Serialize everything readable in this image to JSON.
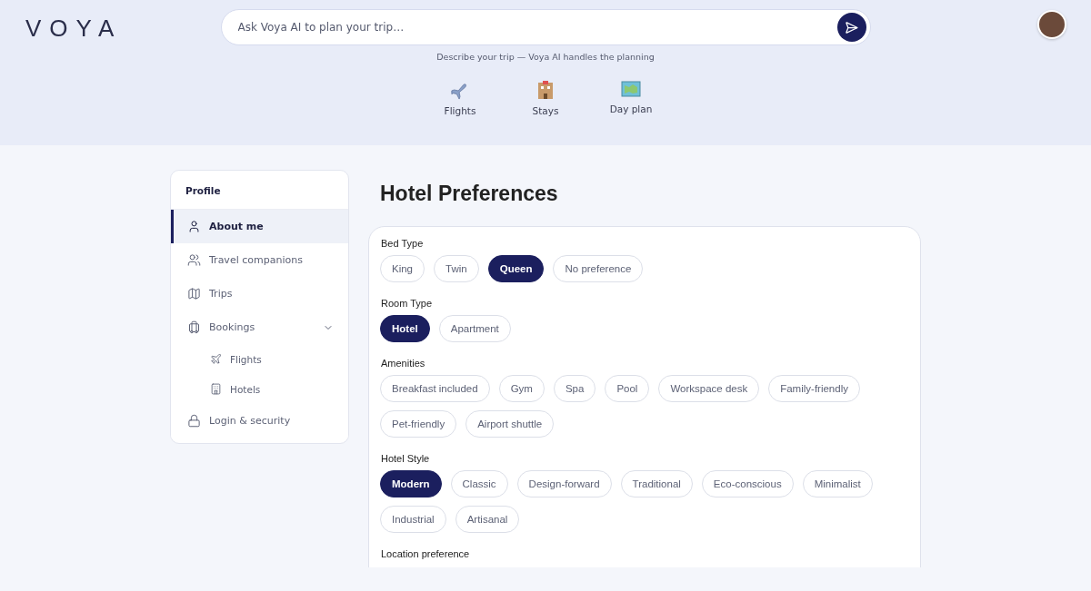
{
  "logo": "VOYA",
  "search": {
    "placeholder": "Ask Voya AI to plan your trip…"
  },
  "tagline": "Describe your trip — Voya AI handles the planning",
  "modes": [
    {
      "kind": "flights",
      "label": "Flights"
    },
    {
      "kind": "stays",
      "label": "Stays"
    },
    {
      "kind": "dayplan",
      "label": "Day plan"
    }
  ],
  "sidebar": {
    "title": "Profile",
    "items": [
      {
        "kind": "user",
        "label": "About me",
        "selected": true
      },
      {
        "kind": "users",
        "label": "Travel companions",
        "selected": false
      },
      {
        "kind": "map",
        "label": "Trips",
        "selected": false
      },
      {
        "kind": "luggage",
        "label": "Bookings",
        "selected": false,
        "expanded": true,
        "children": [
          {
            "kind": "plane",
            "label": "Flights",
            "selected": false
          },
          {
            "kind": "hotel",
            "label": "Hotels",
            "selected": false
          }
        ]
      },
      {
        "kind": "lock",
        "label": "Login & security",
        "selected": false
      }
    ]
  },
  "page_title": "Hotel Preferences",
  "groups": [
    {
      "label": "Bed Type",
      "options": [
        {
          "label": "King",
          "selected": false
        },
        {
          "label": "Twin",
          "selected": false
        },
        {
          "label": "Queen",
          "selected": true
        },
        {
          "label": "No preference",
          "selected": false
        }
      ]
    },
    {
      "label": "Room Type",
      "options": [
        {
          "label": "Hotel",
          "selected": true
        },
        {
          "label": "Apartment",
          "selected": false
        }
      ]
    },
    {
      "label": "Amenities",
      "options": [
        {
          "label": "Breakfast included",
          "selected": false
        },
        {
          "label": "Gym",
          "selected": false
        },
        {
          "label": "Spa",
          "selected": false
        },
        {
          "label": "Pool",
          "selected": false
        },
        {
          "label": "Workspace desk",
          "selected": false
        },
        {
          "label": "Family-friendly",
          "selected": false
        },
        {
          "label": "Pet-friendly",
          "selected": false
        },
        {
          "label": "Airport shuttle",
          "selected": false
        }
      ]
    },
    {
      "label": "Hotel Style",
      "options": [
        {
          "label": "Modern",
          "selected": true
        },
        {
          "label": "Classic",
          "selected": false
        },
        {
          "label": "Design-forward",
          "selected": false
        },
        {
          "label": "Traditional",
          "selected": false
        },
        {
          "label": "Eco-conscious",
          "selected": false
        },
        {
          "label": "Minimalist",
          "selected": false
        },
        {
          "label": "Industrial",
          "selected": false
        },
        {
          "label": "Artisanal",
          "selected": false
        }
      ]
    },
    {
      "label": "Location preference"
    }
  ]
}
